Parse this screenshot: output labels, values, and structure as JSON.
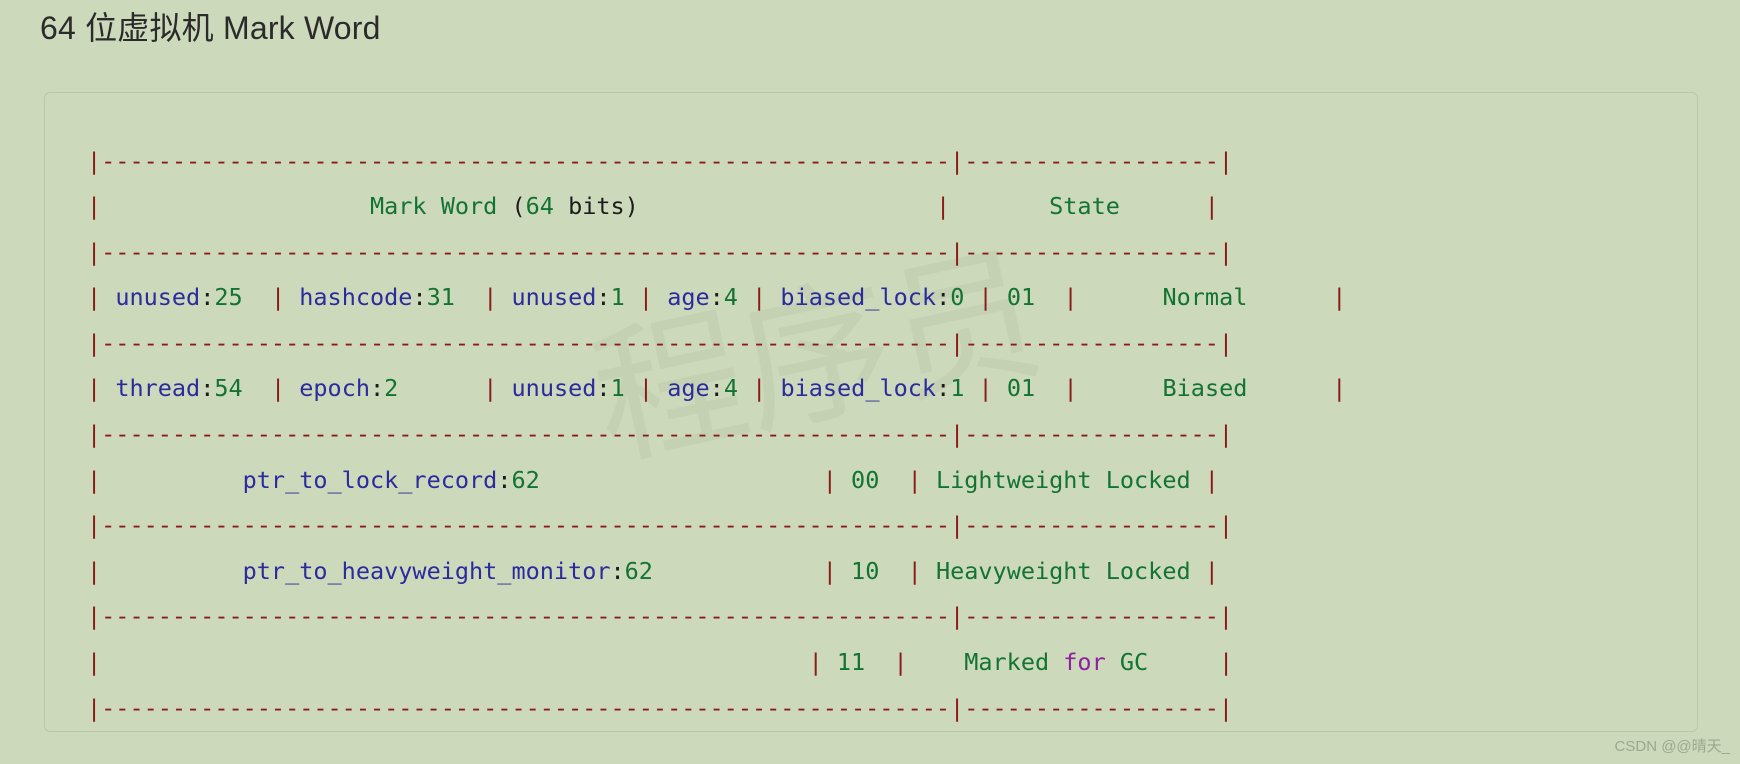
{
  "page": {
    "title": "64 位虚拟机 Mark Word",
    "background_color": "#ccd9bb",
    "card_border_color": "#b9c8a6"
  },
  "colors": {
    "rule": "#8b1a1a",
    "identifier": "#2b2b9e",
    "number": "#137333",
    "plain": "#1c1c1c",
    "state": "#137333",
    "keyword": "#9020a0"
  },
  "code": {
    "language": "text",
    "lines": [
      {
        "id": "rule-top",
        "kind": "separator",
        "text": "|------------------------------------------------------------|------------------|"
      },
      {
        "id": "header",
        "kind": "row",
        "left_label": "Mark Word (64 bits)",
        "state": "State",
        "text": "|                    Mark Word (64 bits)                     |       State      |"
      },
      {
        "id": "rule-1",
        "kind": "separator",
        "text": "|------------------------------------------------------------|------------------|"
      },
      {
        "id": "row-normal",
        "kind": "row",
        "fields": [
          {
            "name": "unused",
            "bits": "25"
          },
          {
            "name": "hashcode",
            "bits": "31"
          },
          {
            "name": "unused",
            "bits": "1"
          },
          {
            "name": "age",
            "bits": "4"
          },
          {
            "name": "biased_lock",
            "bits": "0"
          }
        ],
        "tag_bits": "01",
        "state": "Normal"
      },
      {
        "id": "rule-2",
        "kind": "separator",
        "text": "|------------------------------------------------------------|------------------|"
      },
      {
        "id": "row-biased",
        "kind": "row",
        "fields": [
          {
            "name": "thread",
            "bits": "54"
          },
          {
            "name": "epoch",
            "bits": "2"
          },
          {
            "name": "unused",
            "bits": "1"
          },
          {
            "name": "age",
            "bits": "4"
          },
          {
            "name": "biased_lock",
            "bits": "1"
          }
        ],
        "tag_bits": "01",
        "state": "Biased"
      },
      {
        "id": "rule-3",
        "kind": "separator",
        "text": "|------------------------------------------------------------|------------------|"
      },
      {
        "id": "row-lightweight",
        "kind": "row",
        "fields": [
          {
            "name": "ptr_to_lock_record",
            "bits": "62"
          }
        ],
        "tag_bits": "00",
        "state": "Lightweight Locked"
      },
      {
        "id": "rule-4",
        "kind": "separator",
        "text": "|------------------------------------------------------------|------------------|"
      },
      {
        "id": "row-heavyweight",
        "kind": "row",
        "fields": [
          {
            "name": "ptr_to_heavyweight_monitor",
            "bits": "62"
          }
        ],
        "tag_bits": "10",
        "state": "Heavyweight Locked"
      },
      {
        "id": "rule-5",
        "kind": "separator",
        "text": "|------------------------------------------------------------|------------------|"
      },
      {
        "id": "row-gc",
        "kind": "row",
        "fields": [],
        "tag_bits": "11",
        "state": "Marked for GC",
        "state_keyword": "for"
      },
      {
        "id": "rule-bottom",
        "kind": "separator",
        "text": "|------------------------------------------------------------|------------------|"
      }
    ]
  },
  "watermark": {
    "csdn": "CSDN @@晴天_",
    "background_text": "程序员"
  }
}
